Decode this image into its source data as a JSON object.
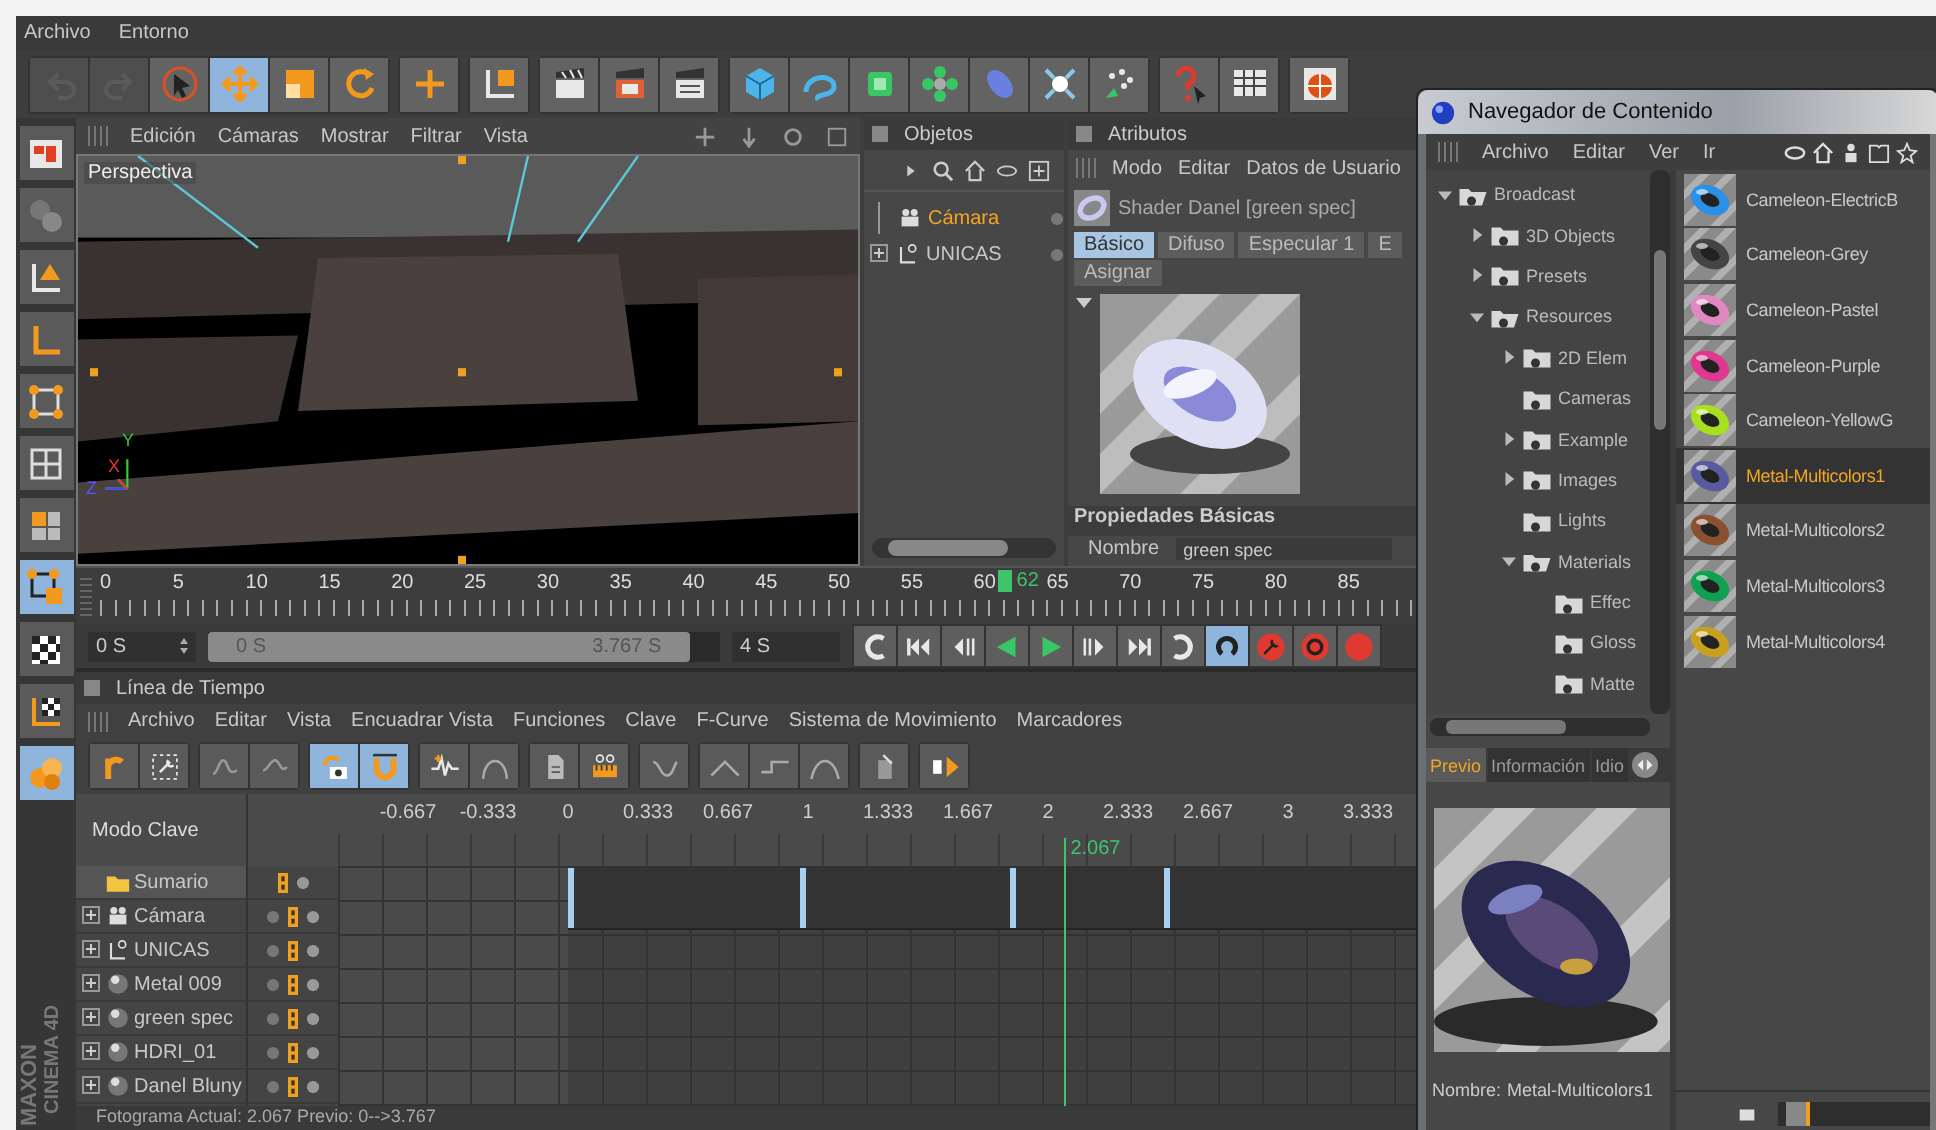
{
  "menubar": [
    "Archivo",
    "Entorno"
  ],
  "toolbar": [
    [
      {
        "kind": "undo",
        "selected": false,
        "disabled": true
      },
      {
        "kind": "redo",
        "selected": false,
        "disabled": true
      },
      {
        "kind": "select",
        "selected": false,
        "disabled": false
      },
      {
        "kind": "move",
        "selected": true,
        "disabled": false
      },
      {
        "kind": "scale",
        "selected": false,
        "disabled": false
      },
      {
        "kind": "rotate",
        "selected": false,
        "disabled": false
      }
    ],
    [
      {
        "kind": "cross",
        "selected": false,
        "disabled": false
      }
    ],
    [
      {
        "kind": "coords",
        "selected": false,
        "disabled": false
      }
    ],
    [
      {
        "kind": "clapper",
        "selected": false,
        "disabled": false
      },
      {
        "kind": "clapper2",
        "selected": false,
        "disabled": false
      },
      {
        "kind": "clapper3",
        "selected": false,
        "disabled": false
      }
    ],
    [
      {
        "kind": "cube",
        "selected": false,
        "disabled": false
      },
      {
        "kind": "spline",
        "selected": false,
        "disabled": false
      },
      {
        "kind": "nurbs",
        "selected": false,
        "disabled": false
      },
      {
        "kind": "array",
        "selected": false,
        "disabled": false
      },
      {
        "kind": "deformer",
        "selected": false,
        "disabled": false
      },
      {
        "kind": "burst",
        "selected": false,
        "disabled": false
      },
      {
        "kind": "particles",
        "selected": false,
        "disabled": false
      }
    ],
    [
      {
        "kind": "help",
        "selected": false,
        "disabled": false
      },
      {
        "kind": "table",
        "selected": false,
        "disabled": false
      }
    ],
    [
      {
        "kind": "globe",
        "selected": false,
        "disabled": false
      }
    ]
  ],
  "side_tools": [
    {
      "kind": "layout",
      "selected": false
    },
    {
      "kind": "sculpt",
      "selected": false
    },
    {
      "kind": "axistri",
      "selected": false
    },
    {
      "kind": "axisl",
      "selected": false
    },
    {
      "kind": "points",
      "selected": false
    },
    {
      "kind": "grid",
      "selected": false
    },
    {
      "kind": "quad",
      "selected": false
    },
    {
      "kind": "points2",
      "selected": true
    },
    {
      "kind": "checker",
      "selected": false
    },
    {
      "kind": "axischeck",
      "selected": false
    },
    {
      "kind": "spheres",
      "selected": true
    }
  ],
  "logo": [
    "MAXON",
    "CINEMA 4D"
  ],
  "viewport": {
    "menu": [
      "Edición",
      "Cámaras",
      "Mostrar",
      "Filtrar",
      "Vista"
    ],
    "camera": "Perspectiva",
    "axes": [
      "Y",
      "X",
      "Z"
    ]
  },
  "objects": {
    "title": "Objetos",
    "items": [
      {
        "label": "Cámara",
        "kind": "camera",
        "selected": true
      },
      {
        "label": "UNICAS",
        "kind": "null",
        "selected": false,
        "expanded": false
      }
    ]
  },
  "attributes": {
    "title": "Atributos",
    "menu": [
      "Modo",
      "Editar",
      "Datos de Usuario"
    ],
    "shader": "Shader Danel [green spec]",
    "tabs": [
      {
        "label": "Básico",
        "selected": true
      },
      {
        "label": "Difuso",
        "selected": false
      },
      {
        "label": "Especular 1",
        "selected": false
      },
      {
        "label": "E",
        "selected": false
      }
    ],
    "tabs_row2": [
      {
        "label": "Asignar",
        "selected": false
      }
    ],
    "section": "Propiedades Básicas",
    "field_label": "Nombre",
    "field_value": "green spec"
  },
  "ruler": {
    "labels": [
      "0",
      "5",
      "10",
      "15",
      "20",
      "25",
      "30",
      "35",
      "40",
      "45",
      "50",
      "55",
      "60",
      "65",
      "70",
      "75",
      "80",
      "85"
    ],
    "current": "62",
    "level": 0.689
  },
  "transport": {
    "start": "0 S",
    "range": {
      "from": "0 S",
      "to": "3.767 S",
      "level": 0.94
    },
    "end": "4 S",
    "buttons": [
      {
        "kind": "loopl",
        "selected": false
      },
      {
        "kind": "first",
        "selected": false
      },
      {
        "kind": "prevkey",
        "selected": false
      },
      {
        "kind": "prev",
        "selected": false
      },
      {
        "kind": "play",
        "selected": false
      },
      {
        "kind": "nextkey",
        "selected": false
      },
      {
        "kind": "last",
        "selected": false
      },
      {
        "kind": "loopr",
        "selected": false
      },
      {
        "kind": "loopsel",
        "selected": true
      },
      {
        "kind": "reckey",
        "selected": false
      },
      {
        "kind": "recrot",
        "selected": false
      },
      {
        "kind": "rec3",
        "selected": false
      }
    ]
  },
  "timeline": {
    "title": "Línea de Tiempo",
    "menu": [
      "Archivo",
      "Editar",
      "Vista",
      "Encuadrar Vista",
      "Funciones",
      "Clave",
      "F-Curve",
      "Sistema de Movimiento",
      "Marcadores"
    ],
    "tools": [
      [
        {
          "kind": "hook",
          "selected": false
        },
        {
          "kind": "keysel",
          "selected": false
        }
      ],
      [
        {
          "kind": "curve",
          "selected": false
        },
        {
          "kind": "curve2",
          "selected": false
        }
      ],
      [
        {
          "kind": "camkey",
          "selected": true
        },
        {
          "kind": "magnet",
          "selected": true
        }
      ],
      [
        {
          "kind": "wave",
          "selected": false
        },
        {
          "kind": "arc",
          "selected": false
        }
      ],
      [
        {
          "kind": "doc",
          "selected": false
        },
        {
          "kind": "ruler",
          "selected": false
        }
      ],
      [
        {
          "kind": "pencil",
          "selected": false
        }
      ],
      [
        {
          "kind": "line1",
          "selected": false
        },
        {
          "kind": "line2",
          "selected": false
        },
        {
          "kind": "line3",
          "selected": false
        }
      ],
      [
        {
          "kind": "dockey",
          "selected": false
        }
      ],
      [
        {
          "kind": "play2",
          "selected": false
        }
      ]
    ],
    "mode": "Modo Clave",
    "scale": [
      "-0.667",
      "-0.333",
      "0",
      "0.333",
      "0.667",
      "1",
      "1.333",
      "1.667",
      "2",
      "2.333",
      "2.667",
      "3",
      "3.333"
    ],
    "playhead": {
      "label": "2.067",
      "level": 0.454
    },
    "keys": [
      {
        "level": 0.144
      },
      {
        "level": 0.289
      },
      {
        "level": 0.42
      },
      {
        "level": 0.516
      }
    ],
    "rows": [
      {
        "label": "Sumario",
        "kind": "folder",
        "selected": true
      },
      {
        "label": "Cámara",
        "kind": "camera",
        "selected": false,
        "expanded": false
      },
      {
        "label": "UNICAS",
        "kind": "null",
        "selected": false,
        "expanded": false
      },
      {
        "label": "Metal 009",
        "kind": "material",
        "selected": false,
        "expanded": false
      },
      {
        "label": "green spec",
        "kind": "material",
        "selected": false,
        "expanded": false
      },
      {
        "label": "HDRI_01",
        "kind": "material",
        "selected": false,
        "expanded": false
      },
      {
        "label": "Danel Bluny",
        "kind": "material",
        "selected": false,
        "expanded": false
      }
    ],
    "status": "Fotograma Actual: 2.067  Previo: 0-->3.767"
  },
  "browser": {
    "title": "Navegador de Contenido",
    "menu": [
      "Archivo",
      "Editar",
      "Ver",
      "Ir"
    ],
    "tree": [
      {
        "label": "Broadcast",
        "expanded": true,
        "children": [
          {
            "label": "3D Objects",
            "expanded": false
          },
          {
            "label": "Presets",
            "expanded": false
          },
          {
            "label": "Resources",
            "expanded": true,
            "children": [
              {
                "label": "2D Elem",
                "expanded": false
              },
              {
                "label": "Cameras"
              },
              {
                "label": "Example",
                "expanded": false
              },
              {
                "label": "Images",
                "expanded": false
              },
              {
                "label": "Lights"
              },
              {
                "label": "Materials",
                "expanded": true,
                "children": [
                  {
                    "label": "Effec"
                  },
                  {
                    "label": "Gloss"
                  },
                  {
                    "label": "Matte"
                  }
                ]
              }
            ]
          }
        ]
      }
    ],
    "tabs": [
      {
        "label": "Previo",
        "selected": true
      },
      {
        "label": "Información",
        "selected": false
      },
      {
        "label": "Idio",
        "selected": false
      }
    ],
    "name_label": "Nombre:",
    "name_value": "Metal-Multicolors1",
    "materials": [
      {
        "label": "Cameleon-ElectricB",
        "selected": false
      },
      {
        "label": "Cameleon-Grey",
        "selected": false
      },
      {
        "label": "Cameleon-Pastel",
        "selected": false
      },
      {
        "label": "Cameleon-Purple",
        "selected": false
      },
      {
        "label": "Cameleon-YellowG",
        "selected": false
      },
      {
        "label": "Metal-Multicolors1",
        "selected": true
      },
      {
        "label": "Metal-Multicolors2",
        "selected": false
      },
      {
        "label": "Metal-Multicolors3",
        "selected": false
      },
      {
        "label": "Metal-Multicolors4",
        "selected": false
      }
    ],
    "zoom": {
      "level": 0.05
    }
  }
}
